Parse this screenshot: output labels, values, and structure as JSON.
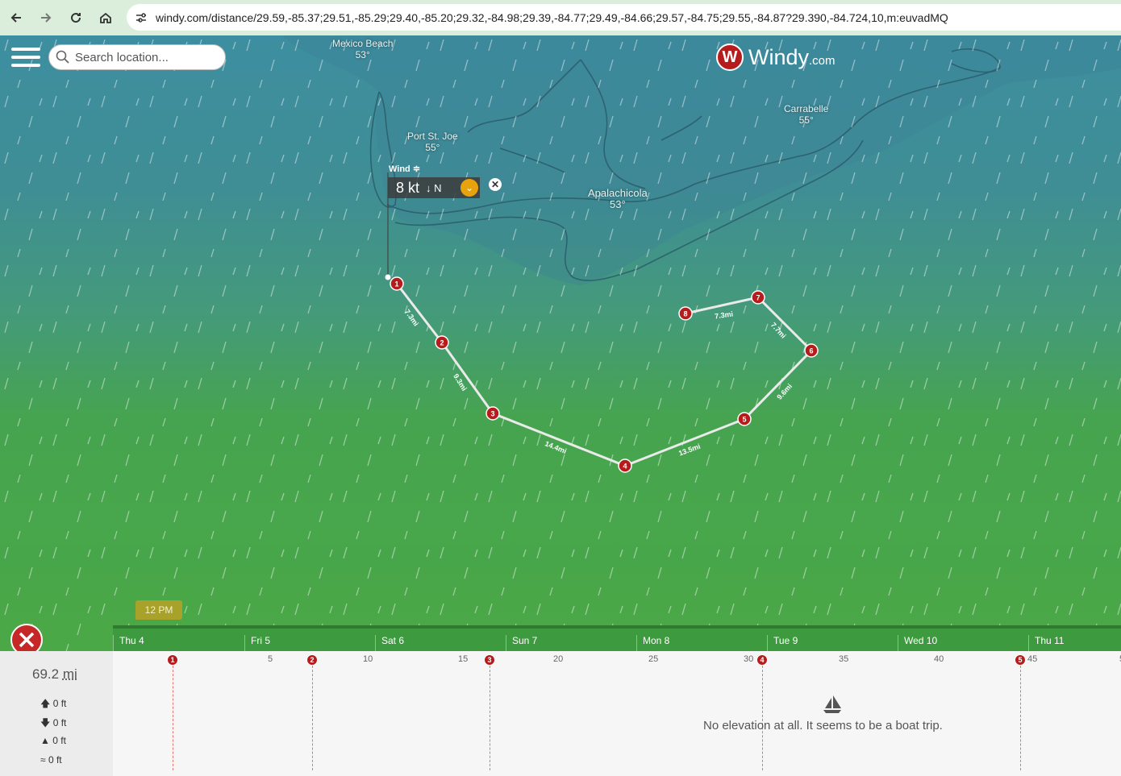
{
  "browser": {
    "url": "windy.com/distance/29.59,-85.37;29.51,-85.29;29.40,-85.20;29.32,-84.98;29.39,-84.77;29.49,-84.66;29.57,-84.75;29.55,-84.87?29.390,-84.724,10,m:euvadMQ"
  },
  "search": {
    "placeholder": "Search location..."
  },
  "logo": {
    "name": "Windy",
    "suffix": ".com"
  },
  "cities": [
    {
      "name": "Mexico Beach",
      "temp": "53°"
    },
    {
      "name": "Port St. Joe",
      "temp": "55°"
    },
    {
      "name": "Apalachicola",
      "temp": "53°"
    },
    {
      "name": "Carrabelle",
      "temp": "55°"
    }
  ],
  "wind": {
    "label": "Wind",
    "value": "8 kt",
    "direction": "N"
  },
  "waypoints": [
    "1",
    "2",
    "3",
    "4",
    "5",
    "6",
    "7",
    "8"
  ],
  "segments": [
    "7.3mi",
    "9.3mi",
    "14.4mi",
    "13.5mi",
    "9.6mi",
    "7.7mi",
    "7.3mi"
  ],
  "timeline": {
    "current": "12 PM",
    "days": [
      "Thu 4",
      "Fri 5",
      "Sat 6",
      "Sun 7",
      "Mon 8",
      "Tue 9",
      "Wed 10",
      "Thu 11"
    ]
  },
  "summary": {
    "distance": "69.2",
    "distance_unit": "mi",
    "ascent": "0",
    "descent": "0",
    "max_elev": "0",
    "avg_elev": "0",
    "unit": "ft"
  },
  "profile": {
    "scale": [
      "5",
      "10",
      "15",
      "20",
      "25",
      "30",
      "35",
      "40",
      "45",
      "5"
    ],
    "message": "No elevation at all. It seems to be a boat trip."
  }
}
